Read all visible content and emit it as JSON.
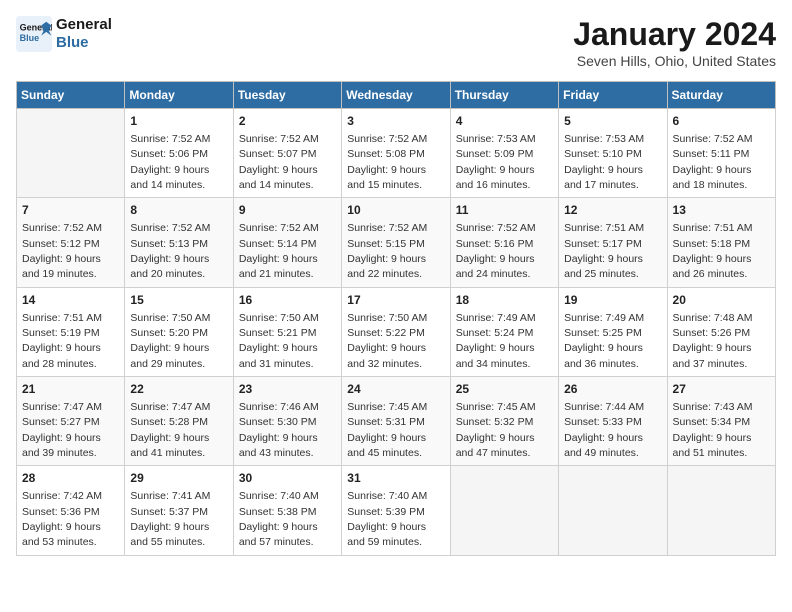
{
  "logo": {
    "line1": "General",
    "line2": "Blue"
  },
  "title": "January 2024",
  "subtitle": "Seven Hills, Ohio, United States",
  "days_of_week": [
    "Sunday",
    "Monday",
    "Tuesday",
    "Wednesday",
    "Thursday",
    "Friday",
    "Saturday"
  ],
  "weeks": [
    [
      {
        "day": "",
        "sunrise": "",
        "sunset": "",
        "daylight": ""
      },
      {
        "day": "1",
        "sunrise": "Sunrise: 7:52 AM",
        "sunset": "Sunset: 5:06 PM",
        "daylight": "Daylight: 9 hours and 14 minutes."
      },
      {
        "day": "2",
        "sunrise": "Sunrise: 7:52 AM",
        "sunset": "Sunset: 5:07 PM",
        "daylight": "Daylight: 9 hours and 14 minutes."
      },
      {
        "day": "3",
        "sunrise": "Sunrise: 7:52 AM",
        "sunset": "Sunset: 5:08 PM",
        "daylight": "Daylight: 9 hours and 15 minutes."
      },
      {
        "day": "4",
        "sunrise": "Sunrise: 7:53 AM",
        "sunset": "Sunset: 5:09 PM",
        "daylight": "Daylight: 9 hours and 16 minutes."
      },
      {
        "day": "5",
        "sunrise": "Sunrise: 7:53 AM",
        "sunset": "Sunset: 5:10 PM",
        "daylight": "Daylight: 9 hours and 17 minutes."
      },
      {
        "day": "6",
        "sunrise": "Sunrise: 7:52 AM",
        "sunset": "Sunset: 5:11 PM",
        "daylight": "Daylight: 9 hours and 18 minutes."
      }
    ],
    [
      {
        "day": "7",
        "sunrise": "Sunrise: 7:52 AM",
        "sunset": "Sunset: 5:12 PM",
        "daylight": "Daylight: 9 hours and 19 minutes."
      },
      {
        "day": "8",
        "sunrise": "Sunrise: 7:52 AM",
        "sunset": "Sunset: 5:13 PM",
        "daylight": "Daylight: 9 hours and 20 minutes."
      },
      {
        "day": "9",
        "sunrise": "Sunrise: 7:52 AM",
        "sunset": "Sunset: 5:14 PM",
        "daylight": "Daylight: 9 hours and 21 minutes."
      },
      {
        "day": "10",
        "sunrise": "Sunrise: 7:52 AM",
        "sunset": "Sunset: 5:15 PM",
        "daylight": "Daylight: 9 hours and 22 minutes."
      },
      {
        "day": "11",
        "sunrise": "Sunrise: 7:52 AM",
        "sunset": "Sunset: 5:16 PM",
        "daylight": "Daylight: 9 hours and 24 minutes."
      },
      {
        "day": "12",
        "sunrise": "Sunrise: 7:51 AM",
        "sunset": "Sunset: 5:17 PM",
        "daylight": "Daylight: 9 hours and 25 minutes."
      },
      {
        "day": "13",
        "sunrise": "Sunrise: 7:51 AM",
        "sunset": "Sunset: 5:18 PM",
        "daylight": "Daylight: 9 hours and 26 minutes."
      }
    ],
    [
      {
        "day": "14",
        "sunrise": "Sunrise: 7:51 AM",
        "sunset": "Sunset: 5:19 PM",
        "daylight": "Daylight: 9 hours and 28 minutes."
      },
      {
        "day": "15",
        "sunrise": "Sunrise: 7:50 AM",
        "sunset": "Sunset: 5:20 PM",
        "daylight": "Daylight: 9 hours and 29 minutes."
      },
      {
        "day": "16",
        "sunrise": "Sunrise: 7:50 AM",
        "sunset": "Sunset: 5:21 PM",
        "daylight": "Daylight: 9 hours and 31 minutes."
      },
      {
        "day": "17",
        "sunrise": "Sunrise: 7:50 AM",
        "sunset": "Sunset: 5:22 PM",
        "daylight": "Daylight: 9 hours and 32 minutes."
      },
      {
        "day": "18",
        "sunrise": "Sunrise: 7:49 AM",
        "sunset": "Sunset: 5:24 PM",
        "daylight": "Daylight: 9 hours and 34 minutes."
      },
      {
        "day": "19",
        "sunrise": "Sunrise: 7:49 AM",
        "sunset": "Sunset: 5:25 PM",
        "daylight": "Daylight: 9 hours and 36 minutes."
      },
      {
        "day": "20",
        "sunrise": "Sunrise: 7:48 AM",
        "sunset": "Sunset: 5:26 PM",
        "daylight": "Daylight: 9 hours and 37 minutes."
      }
    ],
    [
      {
        "day": "21",
        "sunrise": "Sunrise: 7:47 AM",
        "sunset": "Sunset: 5:27 PM",
        "daylight": "Daylight: 9 hours and 39 minutes."
      },
      {
        "day": "22",
        "sunrise": "Sunrise: 7:47 AM",
        "sunset": "Sunset: 5:28 PM",
        "daylight": "Daylight: 9 hours and 41 minutes."
      },
      {
        "day": "23",
        "sunrise": "Sunrise: 7:46 AM",
        "sunset": "Sunset: 5:30 PM",
        "daylight": "Daylight: 9 hours and 43 minutes."
      },
      {
        "day": "24",
        "sunrise": "Sunrise: 7:45 AM",
        "sunset": "Sunset: 5:31 PM",
        "daylight": "Daylight: 9 hours and 45 minutes."
      },
      {
        "day": "25",
        "sunrise": "Sunrise: 7:45 AM",
        "sunset": "Sunset: 5:32 PM",
        "daylight": "Daylight: 9 hours and 47 minutes."
      },
      {
        "day": "26",
        "sunrise": "Sunrise: 7:44 AM",
        "sunset": "Sunset: 5:33 PM",
        "daylight": "Daylight: 9 hours and 49 minutes."
      },
      {
        "day": "27",
        "sunrise": "Sunrise: 7:43 AM",
        "sunset": "Sunset: 5:34 PM",
        "daylight": "Daylight: 9 hours and 51 minutes."
      }
    ],
    [
      {
        "day": "28",
        "sunrise": "Sunrise: 7:42 AM",
        "sunset": "Sunset: 5:36 PM",
        "daylight": "Daylight: 9 hours and 53 minutes."
      },
      {
        "day": "29",
        "sunrise": "Sunrise: 7:41 AM",
        "sunset": "Sunset: 5:37 PM",
        "daylight": "Daylight: 9 hours and 55 minutes."
      },
      {
        "day": "30",
        "sunrise": "Sunrise: 7:40 AM",
        "sunset": "Sunset: 5:38 PM",
        "daylight": "Daylight: 9 hours and 57 minutes."
      },
      {
        "day": "31",
        "sunrise": "Sunrise: 7:40 AM",
        "sunset": "Sunset: 5:39 PM",
        "daylight": "Daylight: 9 hours and 59 minutes."
      },
      {
        "day": "",
        "sunrise": "",
        "sunset": "",
        "daylight": ""
      },
      {
        "day": "",
        "sunrise": "",
        "sunset": "",
        "daylight": ""
      },
      {
        "day": "",
        "sunrise": "",
        "sunset": "",
        "daylight": ""
      }
    ]
  ]
}
